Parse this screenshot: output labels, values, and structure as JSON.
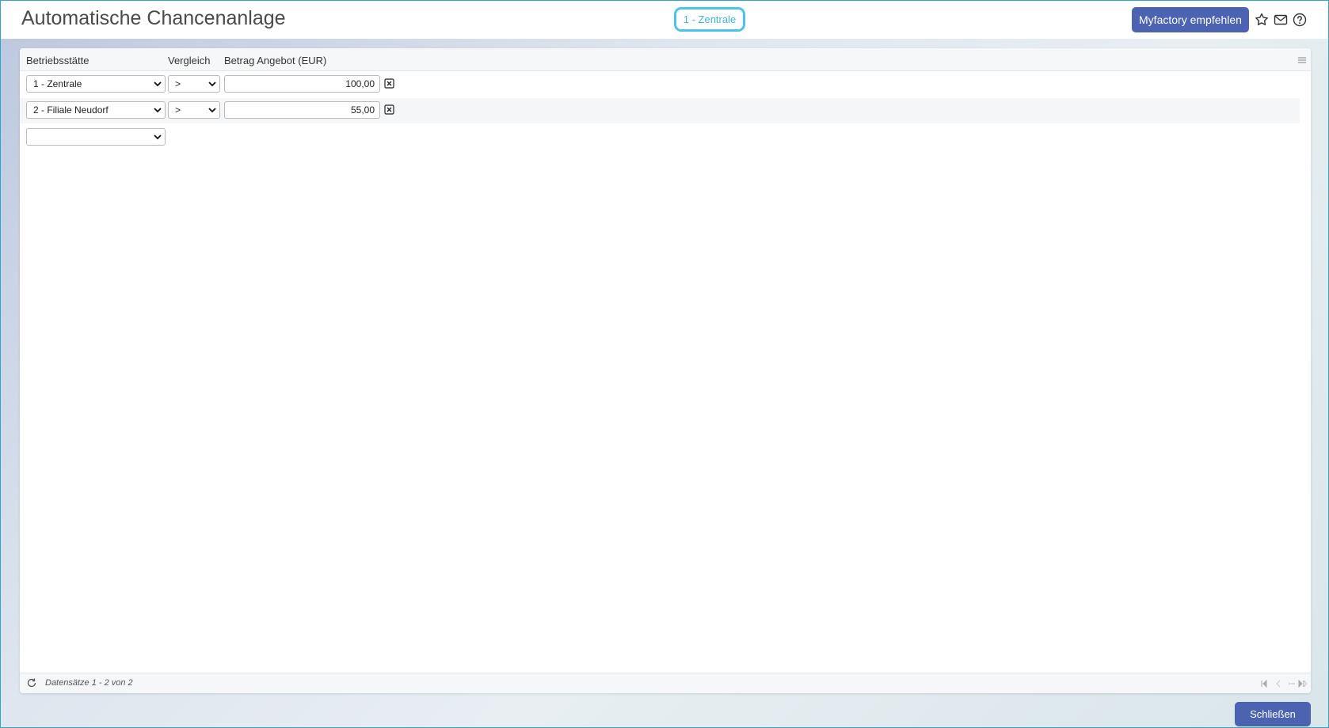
{
  "header": {
    "title": "Automatische Chancenanlage",
    "company": "1 - Zentrale",
    "recommend_label": "Myfactory empfehlen",
    "icons": [
      "star-icon",
      "mail-icon",
      "help-icon"
    ]
  },
  "table": {
    "columns": {
      "site": "Betriebsstätte",
      "compare": "Vergleich",
      "amount": "Betrag Angebot (EUR)"
    },
    "rows": [
      {
        "site": "1 - Zentrale",
        "compare": ">",
        "amount": "100,00"
      },
      {
        "site": "2 - Filiale Neudorf",
        "compare": ">",
        "amount": "55,00"
      }
    ],
    "new_row": {
      "site": ""
    }
  },
  "footer": {
    "records": "Datensätze 1 - 2 von 2"
  },
  "actions": {
    "close_label": "Schließen"
  },
  "colors": {
    "accent": "#4b63b0",
    "company_border": "#4cc3ec"
  }
}
